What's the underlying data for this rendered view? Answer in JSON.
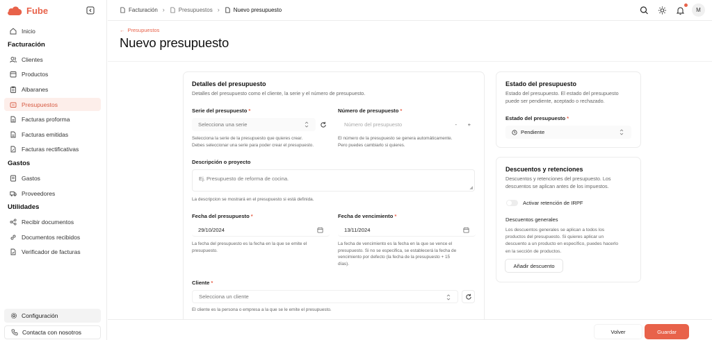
{
  "app": {
    "name": "Fube",
    "brand_color": "#e8624a"
  },
  "sidebar": {
    "home": "Inicio",
    "sections": [
      "Facturación",
      "Gastos",
      "Utilidades"
    ],
    "billing_items": [
      "Clientes",
      "Productos",
      "Albaranes",
      "Presupuestos",
      "Facturas proforma",
      "Facturas emitidas",
      "Facturas rectificativas"
    ],
    "expense_items": [
      "Gastos",
      "Proveedores"
    ],
    "utility_items": [
      "Recibir documentos",
      "Documentos recibidos",
      "Verificador de facturas"
    ],
    "active_item": "Presupuestos",
    "settings": "Configuración",
    "contact": "Contacta con nosotros"
  },
  "breadcrumb": [
    "Facturación",
    "Presupuestos",
    "Nuevo presupuesto"
  ],
  "user_avatar": "M",
  "page": {
    "back_link": "Presupuestos",
    "title": "Nuevo presupuesto"
  },
  "details": {
    "title": "Detalles del presupuesto",
    "description": "Detalles del presupuesto como el cliente, la serie y el número de presupuesto.",
    "series": {
      "label": "Serie del presupuesto",
      "placeholder": "Selecciona una serie",
      "help": [
        "Selecciona la serie de la presupuesto que quieres crear.",
        "Debes seleccionar una serie para poder crear el presupuesto."
      ]
    },
    "number": {
      "label": "Número de presupuesto",
      "placeholder": "Número del presupuesto",
      "minus": "-",
      "plus": "+",
      "help": [
        "El número de la presupuesto se genera automáticamente.",
        "Pero puedes cambiarlo si quieres."
      ]
    },
    "description_field": {
      "label": "Descripción o proyecto",
      "placeholder": "Ej. Presupuesto de reforma de cocina.",
      "help": "La descripcion se mostrará en el presupuesto si está definida."
    },
    "date": {
      "label": "Fecha del presupuesto",
      "value": "29/10/2024",
      "help": [
        "La fecha del presupuesto es la fecha en la que se emite el",
        "presupuesto."
      ]
    },
    "due_date": {
      "label": "Fecha de vencimiento",
      "value": "13/11/2024",
      "help": [
        "La fecha de vencimiento es la fecha en la que se vence el",
        "presupuesto. Si no se especifica, se establecerá la fecha de",
        "vencimiento por defecto (la fecha de la presupuesto + 15",
        "días)."
      ]
    },
    "client": {
      "label": "Cliente",
      "placeholder": "Selecciona un cliente",
      "help": "El cliente es la persona o empresa a la que se le emite el presupuesto."
    },
    "required_mark": "*"
  },
  "status": {
    "title": "Estado del presupuesto",
    "description": [
      "Estado del presupuesto. El estado del presupuesto",
      "puede ser pendiente, aceptado o rechazado."
    ],
    "label": "Estado del presupuesto",
    "value": "Pendiente"
  },
  "discounts": {
    "title": "Descuentos y retenciones",
    "description": [
      "Descuentos y retenciones del presupuesto. Los",
      "descuentos se aplican antes de los impuestos."
    ],
    "irpf_toggle": "Activar retención de IRPF",
    "general_title": "Descuentos generales",
    "general_desc": [
      "Los descuentos generales se aplican a todos los",
      "productos del presupuesto. Si quieres aplicar un",
      "descuento a un producto en específico, puedes hacerlo",
      "en la sección de productos."
    ],
    "add_button": "Añadir descuento"
  },
  "footer": {
    "cancel": "Volver",
    "save": "Guardar"
  }
}
